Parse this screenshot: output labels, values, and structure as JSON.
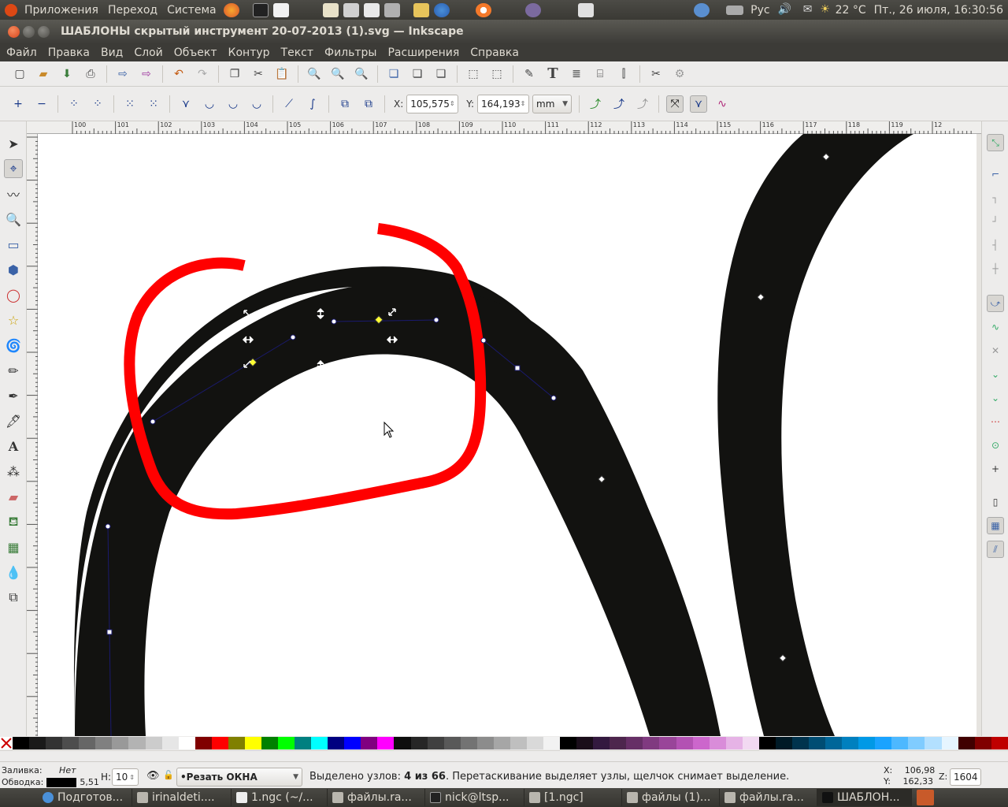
{
  "top_panel": {
    "menus": [
      "Приложения",
      "Переход",
      "Система"
    ],
    "keyboard": "Рус",
    "weather": "22 °C",
    "datetime": "Пт., 26 июля, 16:30:56"
  },
  "window": {
    "title": "ШАБЛОНЫ скрытый инструмент 20-07-2013 (1).svg — Inkscape"
  },
  "menubar": [
    "Файл",
    "Правка",
    "Вид",
    "Слой",
    "Объект",
    "Контур",
    "Текст",
    "Фильтры",
    "Расширения",
    "Справка"
  ],
  "node_toolbar": {
    "x_label": "X:",
    "x_value": "105,575",
    "y_label": "Y:",
    "y_value": "164,193",
    "unit": "mm"
  },
  "ruler": {
    "top_ticks": [
      "100",
      "101",
      "102",
      "103",
      "104",
      "105",
      "106",
      "107",
      "108",
      "109",
      "110",
      "111",
      "112",
      "113",
      "114",
      "115",
      "116",
      "117",
      "118",
      "119",
      "12"
    ]
  },
  "status": {
    "fill_label": "Заливка:",
    "fill_value": "Нет",
    "stroke_label": "Обводка:",
    "stroke_width": "5,51",
    "opacity_label": "Н:",
    "opacity_value": "10",
    "layer": "•Резать ОКНА",
    "message_prefix": "Выделено узлов:",
    "message_count": "4 из 66",
    "message_rest": ". Перетаскивание выделяет узлы, щелчок снимает выделение.",
    "x_label": "X:",
    "x_value": "106,98",
    "y_label": "Y:",
    "y_value": "162,33",
    "zoom_label": "Z:",
    "zoom_value": "1604"
  },
  "taskbar": [
    "Подготов...",
    "irinaldeti....",
    "1.ngc (~/...",
    "файлы.ra...",
    "nick@ltsp...",
    "[1.ngc]",
    "файлы (1)...",
    "файлы.ra...",
    "ШАБЛОН..."
  ],
  "colors": {
    "accent_red": "#ff0000",
    "shape_black": "#121210",
    "path_blue": "#1a1a6e"
  },
  "palette": [
    "#000000",
    "#1a1a1a",
    "#333333",
    "#4d4d4d",
    "#666666",
    "#808080",
    "#999999",
    "#b3b3b3",
    "#cccccc",
    "#e6e6e6",
    "#ffffff",
    "#800000",
    "#ff0000",
    "#808000",
    "#ffff00",
    "#008000",
    "#00ff00",
    "#008080",
    "#00ffff",
    "#000080",
    "#0000ff",
    "#800080",
    "#ff00ff",
    "#0d0d0d",
    "#262626",
    "#404040",
    "#595959",
    "#737373",
    "#8c8c8c",
    "#a6a6a6",
    "#bfbfbf",
    "#d9d9d9",
    "#f2f2f2",
    "#000000",
    "#1a0d1a",
    "#33193f",
    "#4d264d",
    "#662f66",
    "#803a80",
    "#994599",
    "#b352b3",
    "#cc66cc",
    "#d98cd9",
    "#e6b3e6",
    "#f2d9f2",
    "#000000",
    "#001a26",
    "#00334d",
    "#004d73",
    "#006699",
    "#0080bf",
    "#0099e6",
    "#1aa3ff",
    "#4db8ff",
    "#80ccff",
    "#b3e0ff",
    "#e6f5ff",
    "#400000",
    "#800000",
    "#bf0000"
  ]
}
